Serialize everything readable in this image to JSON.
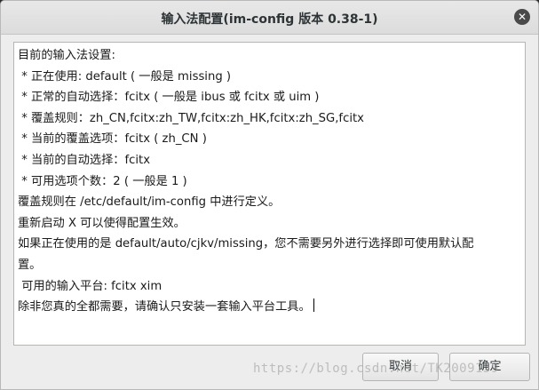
{
  "dialog": {
    "title": "输入法配置(im-config 版本 0.38-1)",
    "close_symbol": "✕"
  },
  "content": {
    "lines": [
      "目前的输入法设置:",
      " * 正在使用: default ( 一般是 missing )",
      " * 正常的自动选择：fcitx ( 一般是 ibus 或 fcitx 或 uim )",
      " * 覆盖规则：zh_CN,fcitx:zh_TW,fcitx:zh_HK,fcitx:zh_SG,fcitx",
      " * 当前的覆盖选项：fcitx ( zh_CN )",
      " * 当前的自动选择：fcitx",
      " * 可用选项个数：2 ( 一般是 1 )",
      "覆盖规则在 /etc/default/im-config 中进行定义。",
      "重新启动 X 可以使得配置生效。",
      "如果正在使用的是 default/auto/cjkv/missing，您不需要另外进行选择即可使用默认配",
      "置。",
      " 可用的输入平台: fcitx xim",
      "除非您真的全都需要，请确认只安装一套输入平台工具。"
    ]
  },
  "buttons": {
    "cancel_label": "取消",
    "ok_label": "确定"
  },
  "watermark": {
    "text": "https://blog.csdn.net/TK2009159"
  }
}
